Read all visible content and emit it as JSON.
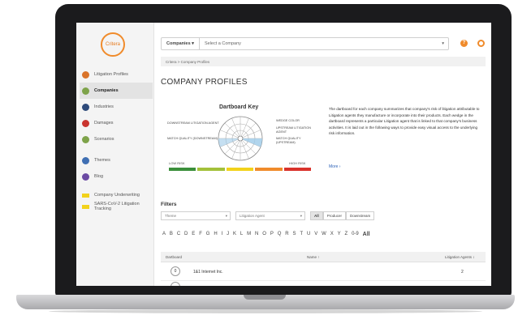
{
  "brand": {
    "logo_text": "Critera",
    "accent": "#f08b2b",
    "link_color": "#2d62b8"
  },
  "sidebar": {
    "items": [
      {
        "label": "Litigation Profiles",
        "icon": "profiles-icon",
        "color": "#d9732a"
      },
      {
        "label": "Companies",
        "icon": "companies-icon",
        "color": "#7ea34a",
        "active": true
      },
      {
        "label": "Industries",
        "icon": "industries-icon",
        "color": "#2d4a7a"
      },
      {
        "label": "Damages",
        "icon": "damages-icon",
        "color": "#c9342f"
      },
      {
        "label": "Scenarios",
        "icon": "scenarios-icon",
        "color": "#7ea34a"
      },
      {
        "label": "Themes",
        "icon": "themes-icon",
        "color": "#3f6fb3"
      },
      {
        "label": "Blog",
        "icon": "blog-icon",
        "color": "#6b4aa3"
      },
      {
        "label": "Company Underwriting",
        "icon": "new-tag-icon",
        "color": "#f2d21b"
      },
      {
        "label": "SARS-CoV-2 Litigation Tracking",
        "icon": "new-tag-icon",
        "color": "#f2d21b"
      }
    ]
  },
  "search": {
    "scope": "Companies",
    "placeholder": "Select a Company"
  },
  "breadcrumb": "Critera > Company Profiles",
  "page_title": "COMPANY PROFILES",
  "dartboard_key": {
    "title": "Dartboard Key",
    "labels_left": [
      "DOWNSTREAM LITIGATION AGENT",
      "MATCH QUALITY (DOWNSTREAM)"
    ],
    "labels_right": [
      "WEDGE COLOR",
      "UPSTREAM LITIGATION AGENT",
      "MATCH QUALITY (UPSTREAM)"
    ],
    "low_risk": "LOW RISK",
    "high_risk": "HIGH RISK",
    "scale_colors": [
      "#3a8f3a",
      "#a3c13a",
      "#f2d21b",
      "#f08b2b",
      "#d9322b"
    ]
  },
  "description": "The dartboard for each company summarizes that company's risk of litigation attributable to Litigation agents they manufacture or incorporate into their products. Each wedge in the dartboard represents a particular Litigation agent that is linked to that company's business activities. It is laid out in the following ways to provide easy visual access to the underlying risk information.",
  "more_link": "More ›",
  "filters": {
    "label": "Filters",
    "theme_placeholder": "Theme",
    "agent_placeholder": "Litigation Agent",
    "toggle": [
      "All",
      "Producer",
      "Downstream"
    ]
  },
  "alphabet": [
    "A",
    "B",
    "C",
    "D",
    "E",
    "F",
    "G",
    "H",
    "I",
    "J",
    "K",
    "L",
    "M",
    "N",
    "O",
    "P",
    "Q",
    "R",
    "S",
    "T",
    "U",
    "V",
    "W",
    "X",
    "Y",
    "Z",
    "0-9",
    "All"
  ],
  "table": {
    "headers": [
      "Dartboard",
      "Name ↑",
      "Litigation Agents ↕"
    ],
    "rows": [
      {
        "name": "1&1 Internet Inc.",
        "agents": "2",
        "badge": "0"
      }
    ]
  }
}
